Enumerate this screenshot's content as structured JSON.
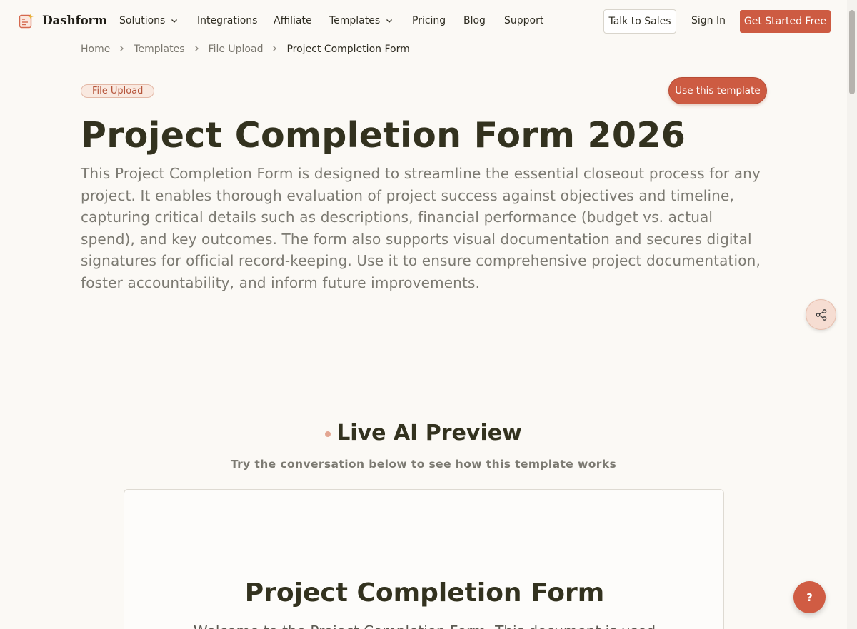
{
  "brand": {
    "name": "Dashform"
  },
  "nav": {
    "items": [
      {
        "label": "Solutions",
        "dropdown": true
      },
      {
        "label": "Integrations",
        "dropdown": false
      },
      {
        "label": "Affiliate",
        "dropdown": false
      },
      {
        "label": "Templates",
        "dropdown": true
      },
      {
        "label": "Pricing",
        "dropdown": false
      },
      {
        "label": "Blog",
        "dropdown": false
      },
      {
        "label": "Support",
        "dropdown": false
      }
    ],
    "talk_to_sales": "Talk to Sales",
    "sign_in": "Sign In",
    "get_started": "Get Started Free"
  },
  "breadcrumb": {
    "items": [
      "Home",
      "Templates",
      "File Upload"
    ],
    "current": "Project Completion Form"
  },
  "hero": {
    "tag": "File Upload",
    "use_template": "Use this template",
    "title": "Project Completion Form 2026",
    "description": "This Project Completion Form is designed to streamline the essential closeout process for any project. It enables thorough evaluation of project success against objectives and timeline, capturing critical details such as descriptions, financial performance (budget vs. actual spend), and key outcomes. The form also supports visual documentation and secures digital signatures for official record-keeping. Use it to ensure comprehensive project documentation, foster accountability, and inform future improvements."
  },
  "preview": {
    "title": "Live AI Preview",
    "subtitle": "Try the conversation below to see how this template works",
    "card_title": "Project Completion Form",
    "card_welcome": "Welcome to the Project Completion Form. This document is used"
  },
  "help": {
    "label": "?"
  },
  "colors": {
    "accent": "#cd5b42",
    "background": "#fbf9f5",
    "text": "#33321f"
  },
  "icons": {
    "share": "share-icon",
    "chevron": "chevron-down-icon",
    "breadcrumb_sep": "chevron-right-icon"
  }
}
